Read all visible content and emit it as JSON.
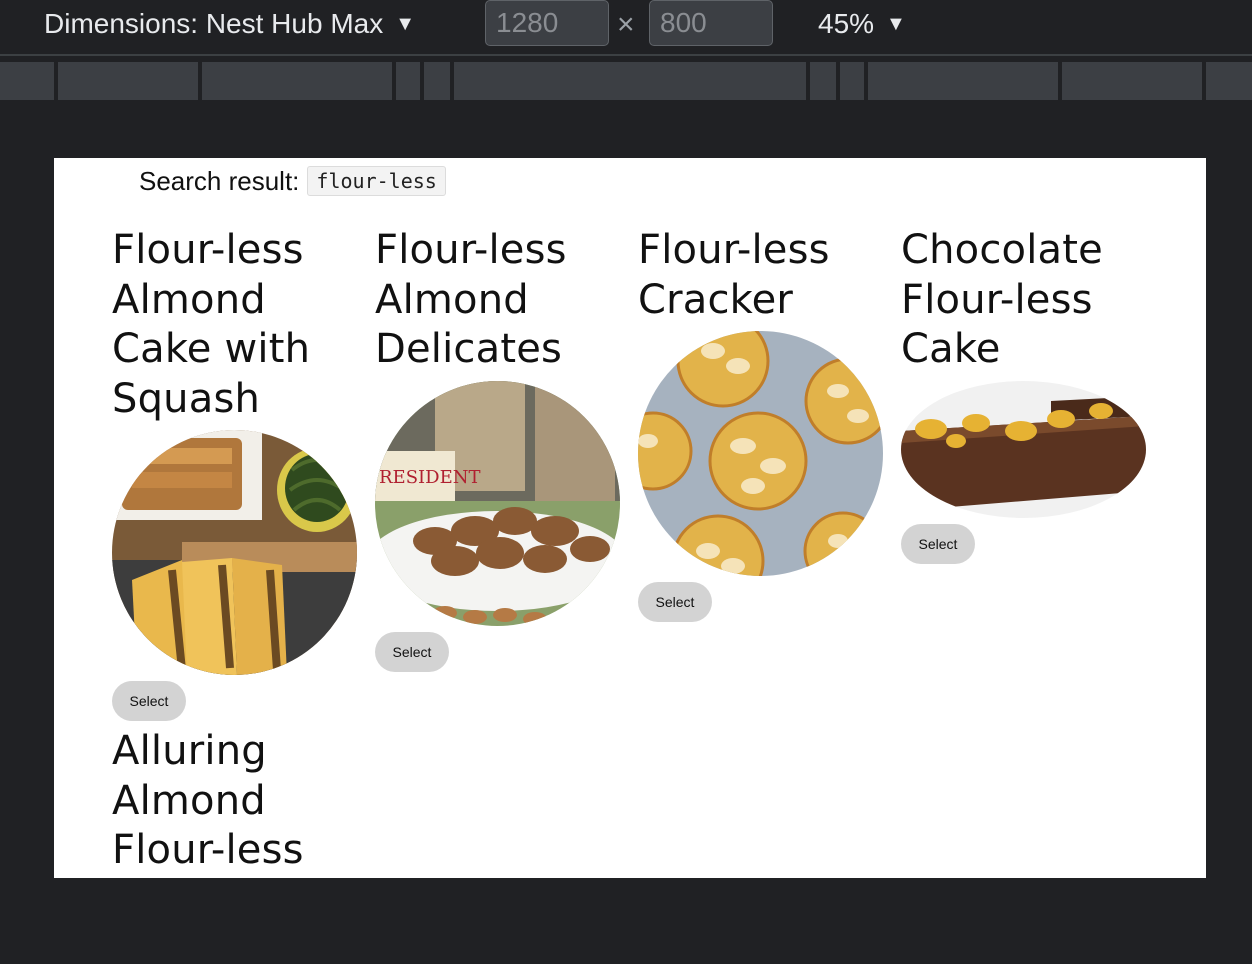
{
  "toolbar": {
    "device_label": "Dimensions: Nest Hub Max",
    "width_value": "1280",
    "height_value": "800",
    "times_glyph": "×",
    "zoom_label": "45%",
    "caret_glyph": "▼"
  },
  "page": {
    "search_label": "Search result:",
    "query": "flour-less",
    "recipes": [
      {
        "title": "Flour-less Almond Cake with Squash",
        "button": "Select",
        "image": "almond-squash-cake-photo"
      },
      {
        "title": "Flour-less Almond Delicates",
        "button": "Select",
        "image": "almond-cookies-photo"
      },
      {
        "title": "Flour-less Cracker",
        "button": "Select",
        "image": "almond-crackers-photo"
      },
      {
        "title": "Chocolate Flour-less Cake",
        "button": "Select",
        "image": "chocolate-cake-photo"
      },
      {
        "title": "Alluring Almond Flour-less",
        "button": "",
        "image": ""
      }
    ]
  },
  "colors": {
    "devtools_bg": "#202124",
    "viewport_bg": "#ffffff",
    "button_bg": "#d3d3d3"
  }
}
